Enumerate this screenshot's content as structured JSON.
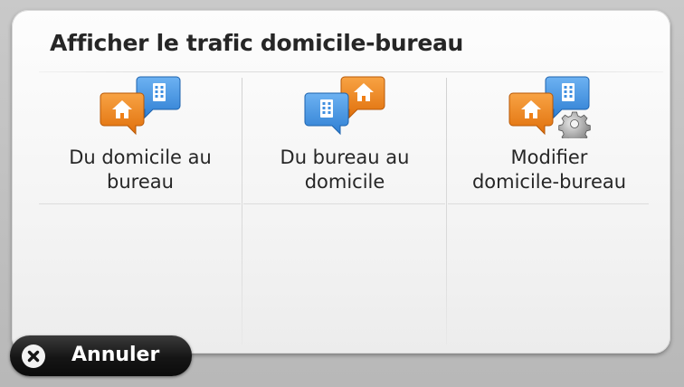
{
  "panel": {
    "title": "Afficher le trafic domicile-bureau"
  },
  "tiles": [
    {
      "label": "Du domicile au\nbureau",
      "icon": "home-to-office-icon"
    },
    {
      "label": "Du bureau au\ndomicile",
      "icon": "office-to-home-icon"
    },
    {
      "label": "Modifier\ndomicile-bureau",
      "icon": "edit-home-office-icon"
    }
  ],
  "cancel": {
    "label": "Annuler",
    "icon": "close-icon"
  },
  "colors": {
    "home_marker": "#f07f15",
    "office_marker": "#3f8fe0",
    "text": "#262626",
    "cancel_bg": "#151515"
  }
}
